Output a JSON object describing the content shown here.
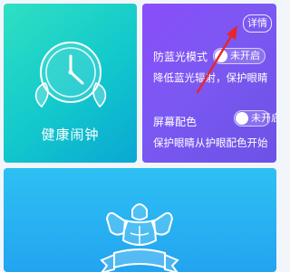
{
  "alarm_card": {
    "title": "健康闹钟",
    "icon": "alarm-clock-icon"
  },
  "eye_card": {
    "detail_button": "详情",
    "blue_light": {
      "label": "防蓝光模式",
      "toggle_text": "未开启",
      "desc": "降低蓝光辐射，保护眼睛"
    },
    "screen_color": {
      "label": "屏幕配色",
      "toggle_text": "未开启",
      "desc": "保护眼睛从护眼配色开始"
    }
  },
  "fitness_card": {
    "icon": "muscle-man-icon"
  },
  "annotation": {
    "icon": "red-arrow-icon",
    "color": "#e8262a"
  },
  "colors": {
    "alarm_card": "#1cd2c8",
    "eye_card": "#7a55f3",
    "fitness_card": "#29b3f2"
  }
}
